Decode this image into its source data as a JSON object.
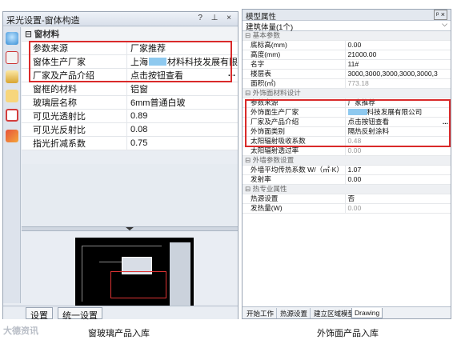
{
  "left": {
    "title": "采光设置-窗体构造",
    "ctrls": "? ⊥ ×",
    "category": "窗材料",
    "rows": [
      {
        "k": "参数来源",
        "v": "厂家推荐"
      },
      {
        "k": "窗体生产厂家",
        "v1": "上海",
        "v2": "材料科技发展有限"
      },
      {
        "k": "厂家及产品介绍",
        "v": "点击按钮查看",
        "btn": "..."
      },
      {
        "k": "窗框的材料",
        "v": "铝窗"
      },
      {
        "k": "玻璃层名称",
        "v": "6mm普通白玻"
      },
      {
        "k": "可见光透射比",
        "v": "0.89"
      },
      {
        "k": "可见光反射比",
        "v": "0.08"
      },
      {
        "k": "指光折减系数",
        "v": "0.75"
      }
    ],
    "tabs": [
      "设置",
      "统一设置"
    ]
  },
  "right": {
    "title": "模型属性",
    "ctrls": "ᵖ ×",
    "select": "建筑体量(1个)",
    "select_arrow": "⌵",
    "sections": [
      {
        "cat": "基本参数",
        "rows": [
          {
            "k": "底标高(mm)",
            "v": "0.00"
          },
          {
            "k": "高度(mm)",
            "v": "21000.00"
          },
          {
            "k": "名字",
            "v": "11#"
          },
          {
            "k": "楼层表",
            "v": "3000,3000,3000,3000,3000,3"
          },
          {
            "k": "面积(㎡)",
            "v": "773.18",
            "gray": true
          }
        ]
      },
      {
        "cat": "外饰面材料设计",
        "rows": [
          {
            "k": "参数来源",
            "v": "厂家推荐"
          },
          {
            "k": "外饰面生产厂家",
            "v2": "科技发展有限公司"
          },
          {
            "k": "厂家及产品介绍",
            "v": "点击按钮查看",
            "btn": "..."
          },
          {
            "k": "外饰面类别",
            "v": "隔热反射涂料"
          }
        ]
      },
      {
        "cat": null,
        "rows": [
          {
            "k": "太阳辐射吸收系数",
            "v": "0.48",
            "gray": true
          },
          {
            "k": "太阳辐射透过率",
            "v": "0.00",
            "gray": true
          }
        ]
      },
      {
        "cat": "外墙参数设置",
        "rows": [
          {
            "k": "外墙平均传热系数 W/（㎡·K）",
            "v": "1.07"
          },
          {
            "k": "发射率",
            "v": "0.00"
          }
        ]
      },
      {
        "cat": "热专业属性",
        "rows": [
          {
            "k": "热源设置",
            "v": "否"
          },
          {
            "k": "发热量(W)",
            "v": "0.00",
            "gray": true
          }
        ]
      }
    ],
    "tabs": [
      "开始工作",
      "热源设置",
      "建立区域模型",
      "Drawing"
    ]
  },
  "captions": {
    "left": "窗玻璃产品入库",
    "right": "外饰面产品入库"
  },
  "watermark": "大德资讯"
}
